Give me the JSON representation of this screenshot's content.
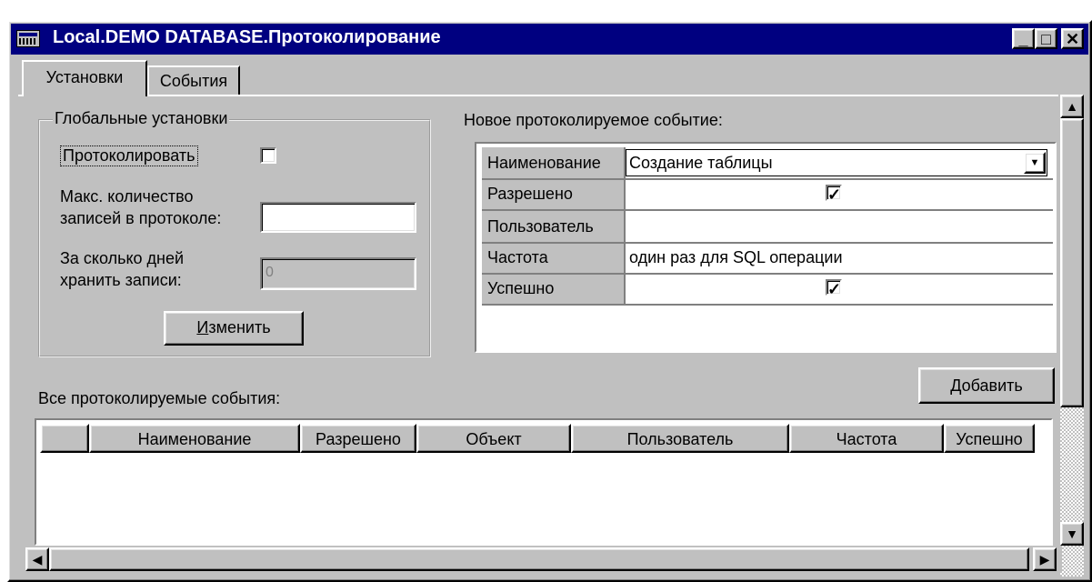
{
  "window": {
    "title": "Local.DEMO DATABASE.Протоколирование",
    "minimize_glyph": "_",
    "maximize_glyph": "□",
    "close_glyph": "✕"
  },
  "tabs": [
    {
      "label": "Установки",
      "active": true
    },
    {
      "label": "События",
      "active": false
    }
  ],
  "global_settings": {
    "group_title": "Глобальные установки",
    "log_label": "Протоколировать",
    "log_checked": false,
    "max_records_label_line1": "Макс. количество",
    "max_records_label_line2": "записей в протоколе:",
    "max_records_value": "",
    "days_label_line1": "За сколько дней",
    "days_label_line2": "хранить записи:",
    "days_value": "0",
    "change_button_first": "И",
    "change_button_rest": "зменить"
  },
  "new_event": {
    "title": "Новое протоколируемое событие:",
    "rows": [
      {
        "label": "Наименование",
        "value": "Создание таблицы",
        "type": "select"
      },
      {
        "label": "Разрешено",
        "value": "",
        "type": "check",
        "checked": true
      },
      {
        "label": "Пользователь",
        "value": "",
        "type": "text"
      },
      {
        "label": "Частота",
        "value": "один раз для SQL операции",
        "type": "text"
      },
      {
        "label": "Успешно",
        "value": "",
        "type": "check",
        "checked": true
      }
    ],
    "dropdown_arrow": "▼",
    "add_button_first": "Д",
    "add_button_rest": "обавить"
  },
  "all_events": {
    "title": "Все протоколируемые события:",
    "columns": [
      "",
      "Наименование",
      "Разрешено",
      "Объект",
      "Пользователь",
      "Частота",
      "Успешно"
    ],
    "rows": []
  },
  "scrollbar": {
    "up_arrow": "▲",
    "down_arrow": "▼",
    "left_arrow": "◀",
    "right_arrow": "▶"
  },
  "colors": {
    "titlebar": "#000080",
    "face": "#c0c0c0"
  }
}
